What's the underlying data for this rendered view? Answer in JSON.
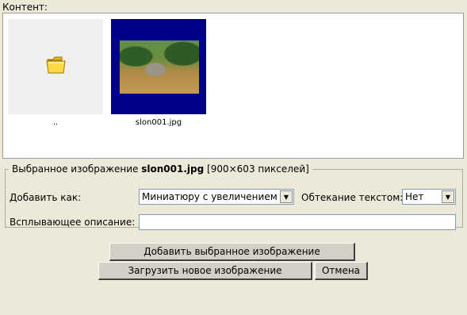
{
  "content_label": "Контент:",
  "gallery": {
    "items": [
      {
        "caption": "..",
        "icon": "folder-icon"
      },
      {
        "caption": "slon001.jpg",
        "selected": true
      }
    ]
  },
  "selected": {
    "legend_prefix": "Выбранное изображение",
    "file_name": "slon001.jpg",
    "dimensions": "[900×603 пикселей]",
    "add_as_label": "Добавить как:",
    "add_as_value": "Миниатюру с увеличением",
    "wrap_label": "Обтекание текстом:",
    "wrap_value": "Нет",
    "tooltip_label": "Всплывающее описание:",
    "tooltip_value": ""
  },
  "buttons": {
    "add_selected": "Добавить выбранное изображение",
    "upload_new": "Загрузить новое изображение",
    "cancel": "Отмена"
  }
}
